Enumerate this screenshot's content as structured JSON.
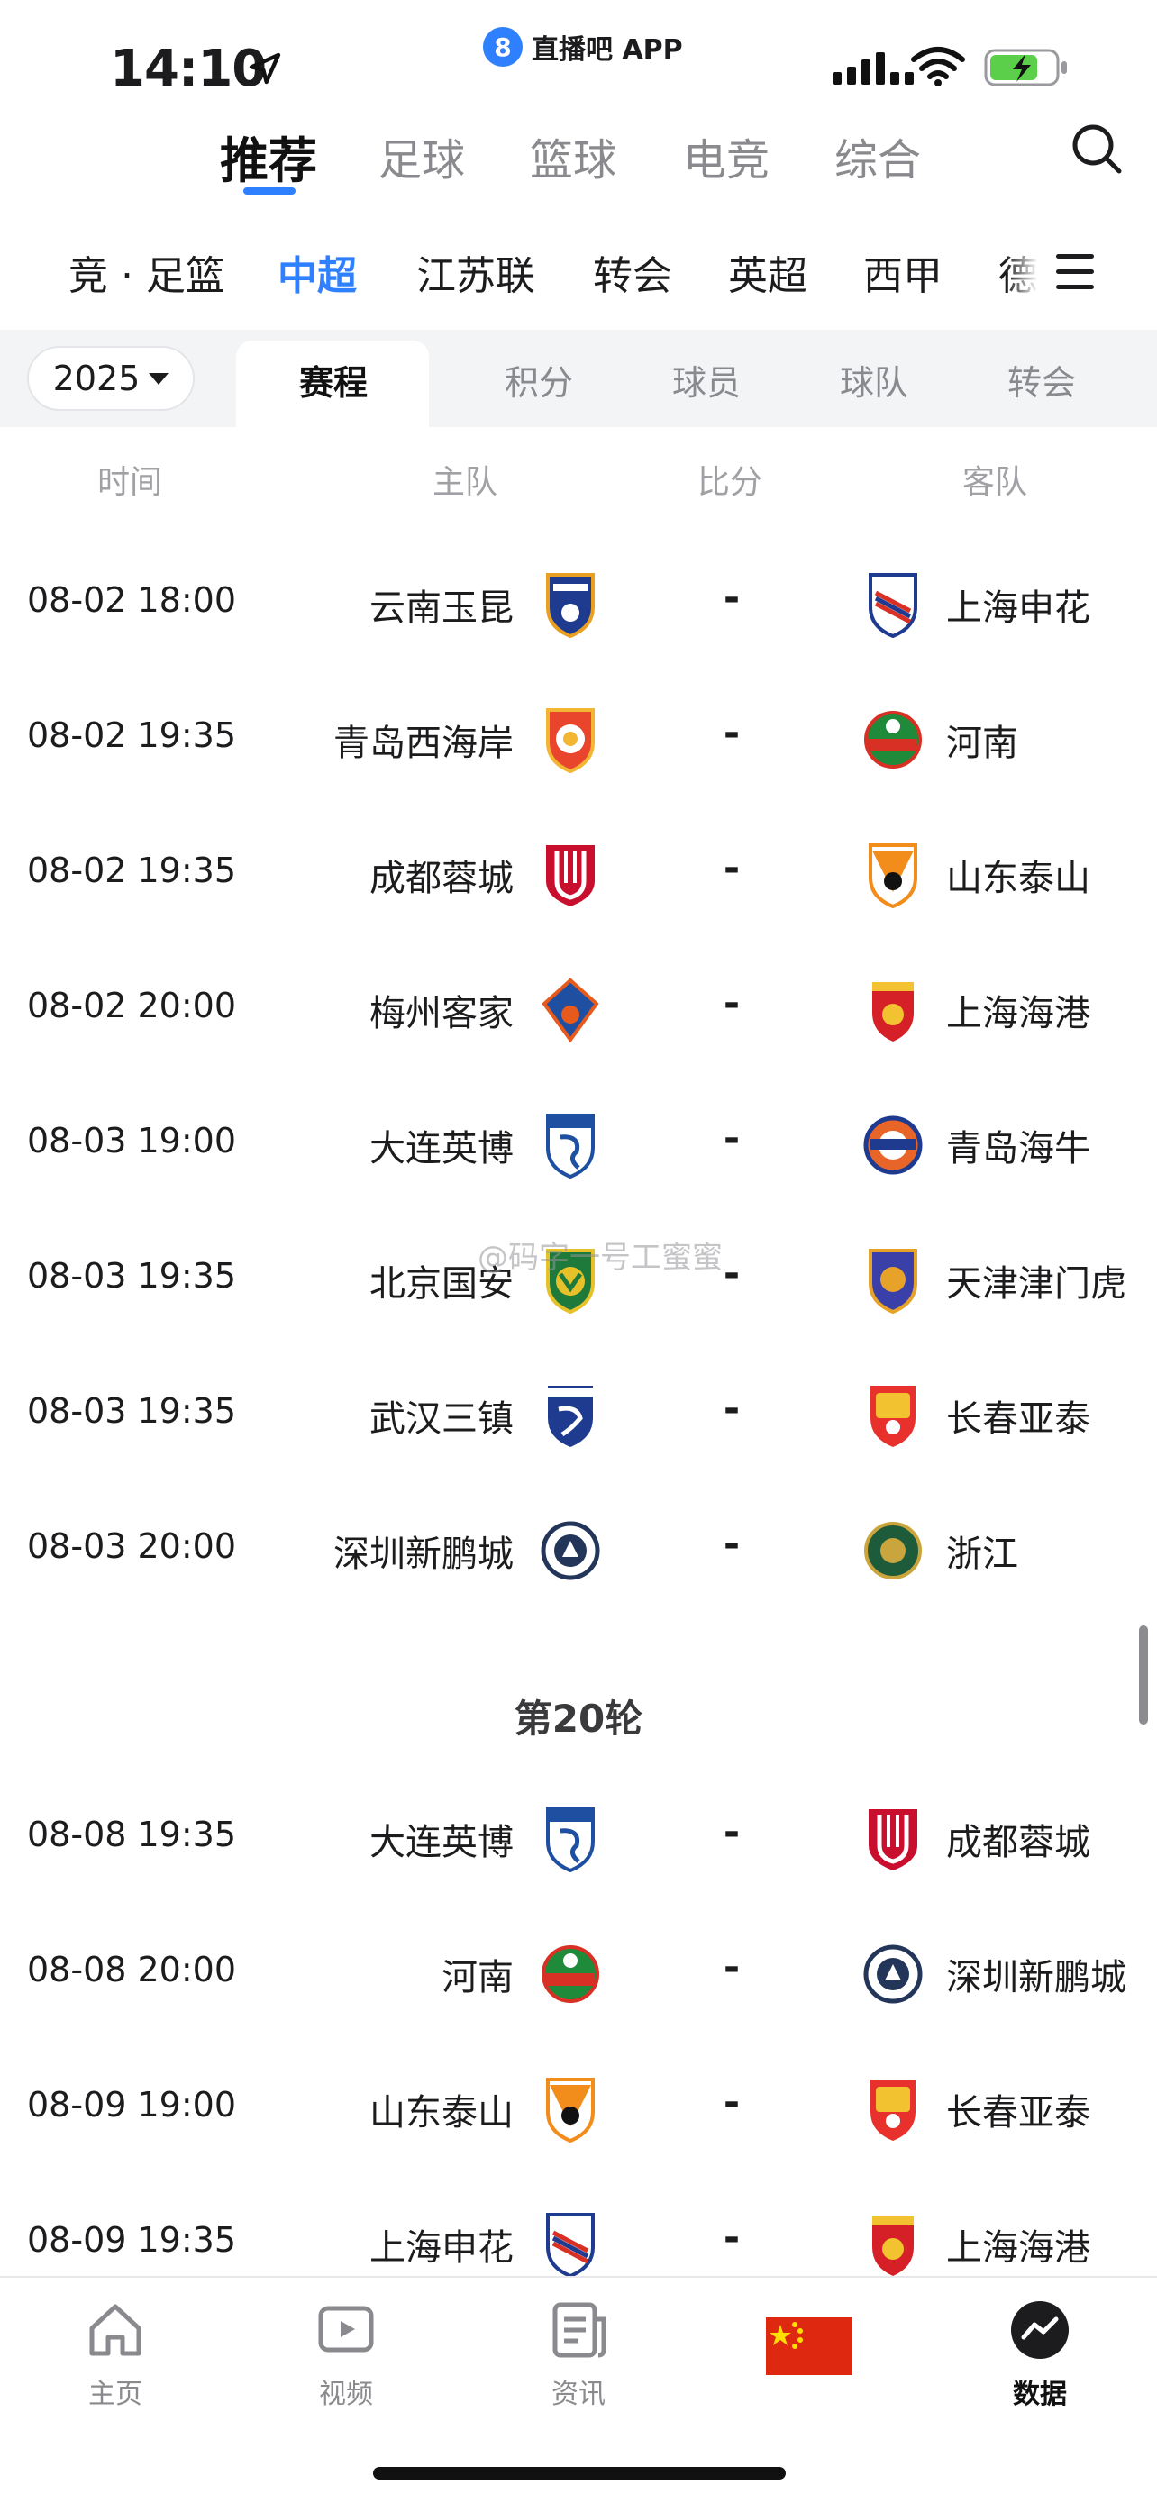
{
  "status_bar": {
    "time": "14:10",
    "app_badge": "8",
    "app_name": "直播吧 APP"
  },
  "primary_tabs": [
    {
      "label": "推荐",
      "active": true
    },
    {
      "label": "足球"
    },
    {
      "label": "篮球"
    },
    {
      "label": "电竞"
    },
    {
      "label": "综合"
    }
  ],
  "leagues": [
    {
      "label": "竞 · 足篮"
    },
    {
      "label": "中超",
      "active": true
    },
    {
      "label": "江苏联"
    },
    {
      "label": "转会"
    },
    {
      "label": "英超"
    },
    {
      "label": "西甲"
    },
    {
      "label": "德"
    }
  ],
  "season": {
    "label": "2025"
  },
  "sub_tabs": [
    {
      "label": "赛程",
      "active": true
    },
    {
      "label": "积分"
    },
    {
      "label": "球员"
    },
    {
      "label": "球队"
    },
    {
      "label": "转会"
    }
  ],
  "columns": {
    "time": "时间",
    "home": "主队",
    "score": "比分",
    "away": "客队"
  },
  "matches_a": [
    {
      "time": "08-02 18:00",
      "home": "云南玉昆",
      "score": "-",
      "away": "上海申花"
    },
    {
      "time": "08-02 19:35",
      "home": "青岛西海岸",
      "score": "-",
      "away": "河南"
    },
    {
      "time": "08-02 19:35",
      "home": "成都蓉城",
      "score": "-",
      "away": "山东泰山"
    },
    {
      "time": "08-02 20:00",
      "home": "梅州客家",
      "score": "-",
      "away": "上海海港"
    },
    {
      "time": "08-03 19:00",
      "home": "大连英博",
      "score": "-",
      "away": "青岛海牛"
    },
    {
      "time": "08-03 19:35",
      "home": "北京国安",
      "score": "-",
      "away": "天津津门虎"
    },
    {
      "time": "08-03 19:35",
      "home": "武汉三镇",
      "score": "-",
      "away": "长春亚泰"
    },
    {
      "time": "08-03 20:00",
      "home": "深圳新鹏城",
      "score": "-",
      "away": "浙江"
    }
  ],
  "round": {
    "title": "第20轮"
  },
  "matches_b": [
    {
      "time": "08-08 19:35",
      "home": "大连英博",
      "score": "-",
      "away": "成都蓉城"
    },
    {
      "time": "08-08 20:00",
      "home": "河南",
      "score": "-",
      "away": "深圳新鹏城"
    },
    {
      "time": "08-09 19:00",
      "home": "山东泰山",
      "score": "-",
      "away": "长春亚泰"
    },
    {
      "time": "08-09 19:35",
      "home": "上海申花",
      "score": "-",
      "away": "上海海港"
    }
  ],
  "watermark": "@码字一号工蜜蜜",
  "bottom_nav": [
    {
      "label": "主页",
      "icon": "home-icon"
    },
    {
      "label": "视频",
      "icon": "video-icon"
    },
    {
      "label": "资讯",
      "icon": "news-icon"
    },
    {
      "label": "",
      "icon": "china-flag-icon"
    },
    {
      "label": "数据",
      "icon": "data-icon",
      "active": true
    }
  ],
  "colors": {
    "accent": "#2f80ff",
    "text": "#1c1c1e",
    "muted": "#8a8a8e"
  }
}
